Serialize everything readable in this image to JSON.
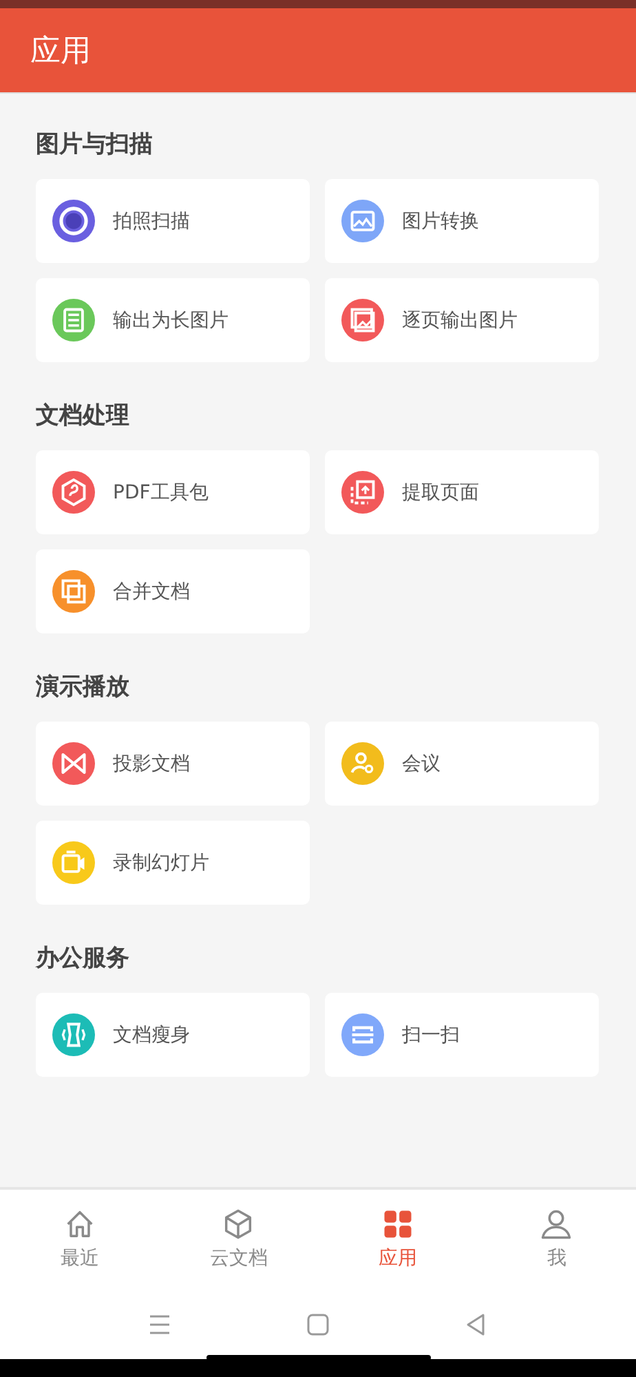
{
  "header": {
    "title": "应用"
  },
  "sections": [
    {
      "title": "图片与扫描",
      "items": [
        {
          "label": "拍照扫描",
          "kind": "scan",
          "color": "#6a5fe0"
        },
        {
          "label": "图片转换",
          "kind": "image",
          "color": "#7ea6f8"
        },
        {
          "label": "输出为长图片",
          "kind": "longimage",
          "color": "#6ac85a"
        },
        {
          "label": "逐页输出图片",
          "kind": "pages",
          "color": "#f2595a"
        }
      ]
    },
    {
      "title": "文档处理",
      "items": [
        {
          "label": "PDF工具包",
          "kind": "hexagon",
          "color": "#f2595a"
        },
        {
          "label": "提取页面",
          "kind": "extract",
          "color": "#f2595a"
        },
        {
          "label": "合并文档",
          "kind": "merge",
          "color": "#f7902b"
        }
      ]
    },
    {
      "title": "演示播放",
      "items": [
        {
          "label": "投影文档",
          "kind": "bowtie",
          "color": "#f2595a"
        },
        {
          "label": "会议",
          "kind": "person",
          "color": "#f2bc1c"
        },
        {
          "label": "录制幻灯片",
          "kind": "camera",
          "color": "#f8c91a"
        }
      ]
    },
    {
      "title": "办公服务",
      "items": [
        {
          "label": "文档瘦身",
          "kind": "slim",
          "color": "#1cbcb6"
        },
        {
          "label": "扫一扫",
          "kind": "qrscan",
          "color": "#80a8fa"
        }
      ]
    }
  ],
  "tabs": [
    {
      "label": "最近",
      "kind": "home",
      "selected": false
    },
    {
      "label": "云文档",
      "kind": "cube",
      "selected": false
    },
    {
      "label": "应用",
      "kind": "grid",
      "selected": true
    },
    {
      "label": "我",
      "kind": "user",
      "selected": false
    }
  ]
}
